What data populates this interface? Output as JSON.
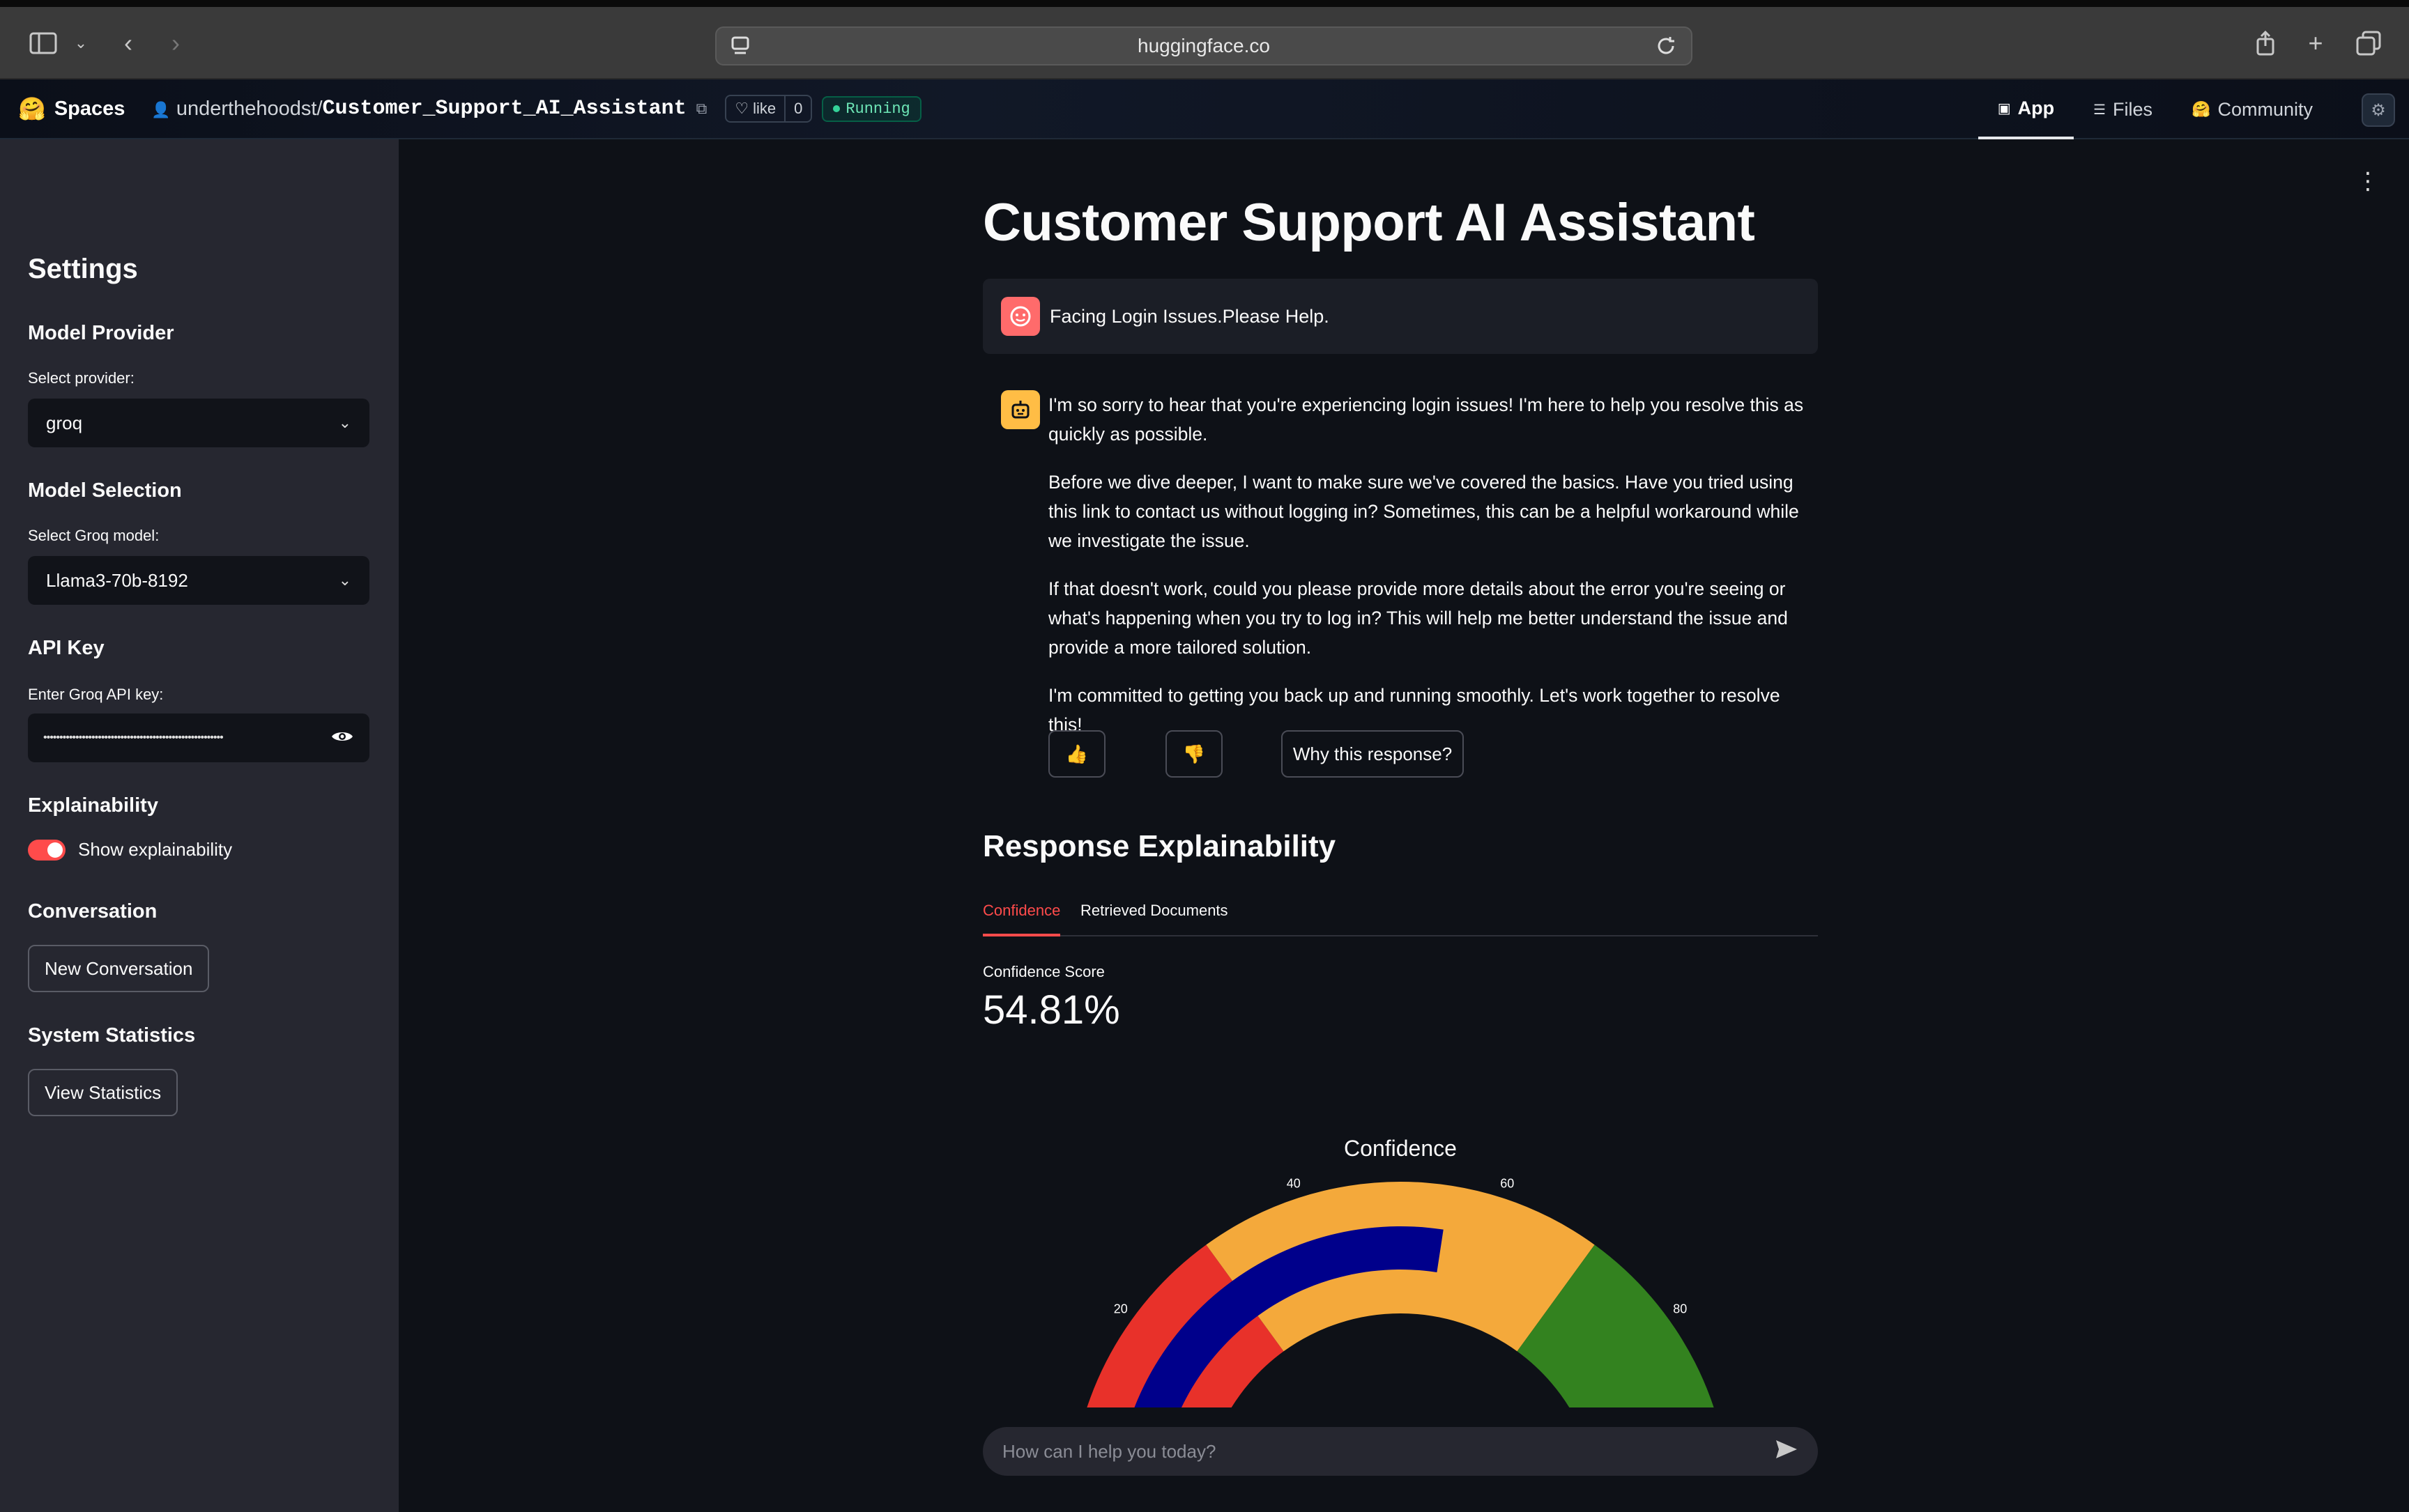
{
  "browser": {
    "url": "huggingface.co"
  },
  "hf": {
    "spaces_label": "Spaces",
    "owner": "underthehoodst",
    "separator": "/",
    "repo": "Customer_Support_AI_Assistant",
    "like_label": "like",
    "like_count": "0",
    "status": "Running",
    "tabs": [
      {
        "label": "App",
        "active": true
      },
      {
        "label": "Files",
        "active": false
      },
      {
        "label": "Community",
        "active": false
      }
    ]
  },
  "sidebar": {
    "title": "Settings",
    "model_provider": {
      "heading": "Model Provider",
      "label": "Select provider:",
      "value": "groq"
    },
    "model_selection": {
      "heading": "Model Selection",
      "label": "Select Groq model:",
      "value": "Llama3-70b-8192"
    },
    "api_key": {
      "heading": "API Key",
      "label": "Enter Groq API key:",
      "masked": "••••••••••••••••••••••••••••••••••••••••••••••••••••••••"
    },
    "explainability": {
      "heading": "Explainability",
      "toggle_label": "Show explainability",
      "enabled": true
    },
    "conversation": {
      "heading": "Conversation",
      "button": "New Conversation"
    },
    "statistics": {
      "heading": "System Statistics",
      "button": "View Statistics"
    }
  },
  "main": {
    "title": "Customer Support AI Assistant",
    "user_message": "Facing Login Issues.Please Help.",
    "assistant_paragraphs": [
      "I'm so sorry to hear that you're experiencing login issues! I'm here to help you resolve this as quickly as possible.",
      "Before we dive deeper, I want to make sure we've covered the basics. Have you tried using this link to contact us without logging in? Sometimes, this can be a helpful workaround while we investigate the issue.",
      "If that doesn't work, could you please provide more details about the error you're seeing or what's happening when you try to log in? This will help me better understand the issue and provide a more tailored solution.",
      "I'm committed to getting you back up and running smoothly. Let's work together to resolve this!"
    ],
    "feedback": {
      "thumbs_up": "👍",
      "thumbs_down": "👎",
      "why": "Why this response?"
    },
    "explainability_heading": "Response Explainability",
    "tabs": [
      {
        "label": "Confidence",
        "active": true
      },
      {
        "label": "Retrieved Documents",
        "active": false
      }
    ],
    "metric_label": "Confidence Score",
    "metric_value": "54.81%",
    "chat_placeholder": "How can I help you today?"
  },
  "chart_data": {
    "type": "gauge",
    "title": "Confidence",
    "value": 54.81,
    "range": [
      0,
      100
    ],
    "ticks": [
      20,
      40,
      60,
      80
    ],
    "steps": [
      {
        "range": [
          0,
          30
        ],
        "color": "#e8312a"
      },
      {
        "range": [
          30,
          70
        ],
        "color": "#f4a93b"
      },
      {
        "range": [
          70,
          100
        ],
        "color": "#33821f"
      }
    ],
    "bar_color": "#00008b"
  }
}
